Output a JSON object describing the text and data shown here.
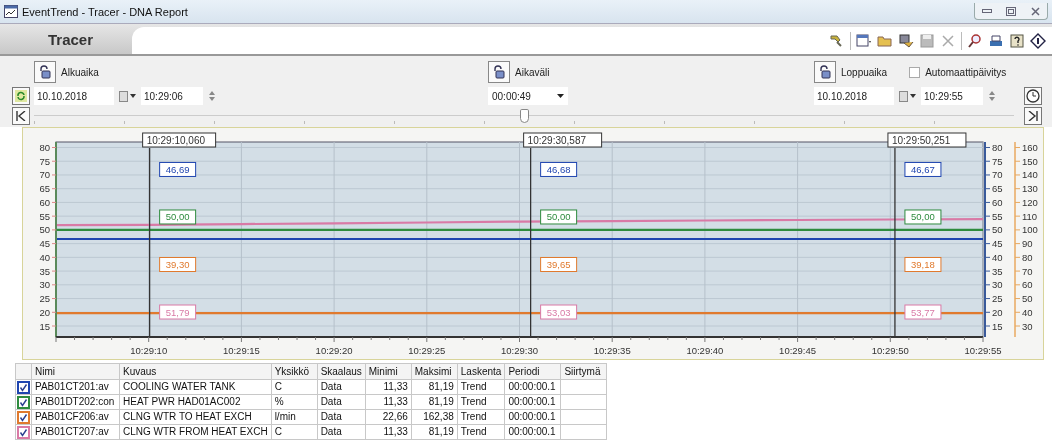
{
  "window": {
    "title": "EventTrend - Tracer - DNA Report"
  },
  "header": {
    "title": "Tracer"
  },
  "controls": {
    "start": {
      "label": "Alkuaika",
      "date": "10.10.2018",
      "time": "10:29:06"
    },
    "interval": {
      "label": "Aikaväli",
      "value": "00:00:49"
    },
    "end": {
      "label": "Loppuaika",
      "date": "10.10.2018",
      "time": "10:29:55"
    },
    "auto_update": {
      "label": "Automaattipäivitys",
      "checked": false
    },
    "slider": {
      "level": 0.5
    }
  },
  "chart": {
    "cursors": [
      {
        "time": "10:29:10,060",
        "level": 0.101,
        "values": [
          "46,69",
          "50,00",
          "39,30",
          "51,79"
        ]
      },
      {
        "time": "10:29:30,587",
        "level": 0.512,
        "values": [
          "46,68",
          "50,00",
          "39,65",
          "53,03"
        ]
      },
      {
        "time": "10:29:50,251",
        "level": 0.905,
        "values": [
          "46,67",
          "50,00",
          "39,18",
          "53,77"
        ]
      }
    ],
    "right_ticks": [
      "80",
      "75",
      "70",
      "65",
      "60",
      "55",
      "50",
      "45",
      "40",
      "35",
      "30",
      "25",
      "20",
      "15"
    ],
    "chart_data": {
      "type": "line",
      "grid": true,
      "y2lim": [
        22,
        164
      ],
      "y2ticks": [
        160,
        150,
        140,
        130,
        120,
        110,
        100,
        90,
        80,
        70,
        60,
        50,
        40,
        30
      ],
      "categories": [
        null,
        "10:29:10",
        "10:29:15",
        "10:29:20",
        "10:29:25",
        "10:29:30",
        "10:29:35",
        "10:29:40",
        "10:29:45",
        "10:29:50",
        "10:29:55"
      ],
      "ylim": [
        11,
        82
      ],
      "yticks": [
        {
          "value": 80,
          "label": "80"
        },
        {
          "value": 75,
          "label": "75"
        },
        {
          "value": 70,
          "label": "70"
        },
        {
          "value": 65,
          "label": "65"
        },
        {
          "value": 60,
          "label": "60"
        },
        {
          "value": 55,
          "label": "55"
        },
        {
          "value": 50,
          "label": "50"
        },
        {
          "value": 45,
          "label": "45"
        },
        {
          "value": 40,
          "label": "40"
        },
        {
          "value": 35,
          "label": "35"
        },
        {
          "value": 30,
          "label": "30"
        },
        {
          "value": 25,
          "label": "25"
        },
        {
          "value": 20,
          "label": "20"
        },
        {
          "value": 15,
          "label": "15"
        }
      ],
      "series": [
        {
          "color": "#1f45b0",
          "values": [
            46.7,
            46.7,
            46.7,
            46.7,
            46.7,
            46.7,
            46.7,
            46.7,
            46.7,
            46.7,
            46.7
          ]
        },
        {
          "color": "#2e8b3e",
          "values": [
            50,
            50,
            50,
            50,
            50,
            50,
            50,
            50,
            50,
            50,
            50
          ]
        },
        {
          "color": "#e07a2e",
          "axis": "y2",
          "values": [
            39.3,
            39.3,
            39.3,
            39.3,
            39.3,
            39.3,
            39.3,
            39.3,
            39.3,
            39.3,
            39.3
          ]
        },
        {
          "color": "#d97aa6",
          "values": [
            51.7,
            51.8,
            52.1,
            52.4,
            52.7,
            53.0,
            53.2,
            53.4,
            53.6,
            53.8,
            53.9
          ]
        }
      ]
    }
  },
  "table": {
    "columns": [
      "Nimi",
      "Kuvaus",
      "Yksikkö",
      "Skaalaus",
      "Minimi",
      "Maksimi",
      "Laskenta",
      "Periodi",
      "Siirtymä"
    ],
    "rows": [
      {
        "color": "#1f45b0",
        "checked": true,
        "cells": [
          "PAB01CT201:av",
          "COOLING WATER TANK",
          "C",
          "Data",
          "11,33",
          "81,19",
          "Trend",
          "00:00:00.1",
          ""
        ]
      },
      {
        "color": "#2e8b3e",
        "checked": true,
        "cells": [
          "PAB01DT202:con",
          "HEAT PWR HAD01AC002",
          "%",
          "Data",
          "11,33",
          "81,19",
          "Trend",
          "00:00:00.1",
          ""
        ]
      },
      {
        "color": "#e07a2e",
        "checked": true,
        "cells": [
          "PAB01CF206:av",
          "CLNG WTR TO HEAT EXCH",
          "l/min",
          "Data",
          "22,66",
          "162,38",
          "Trend",
          "00:00:00.1",
          ""
        ]
      },
      {
        "color": "#d97aa6",
        "checked": true,
        "cells": [
          "PAB01CT207:av",
          "CLNG WTR FROM HEAT EXCH",
          "C",
          "Data",
          "11,33",
          "81,19",
          "Trend",
          "00:00:00.1",
          ""
        ]
      }
    ]
  }
}
